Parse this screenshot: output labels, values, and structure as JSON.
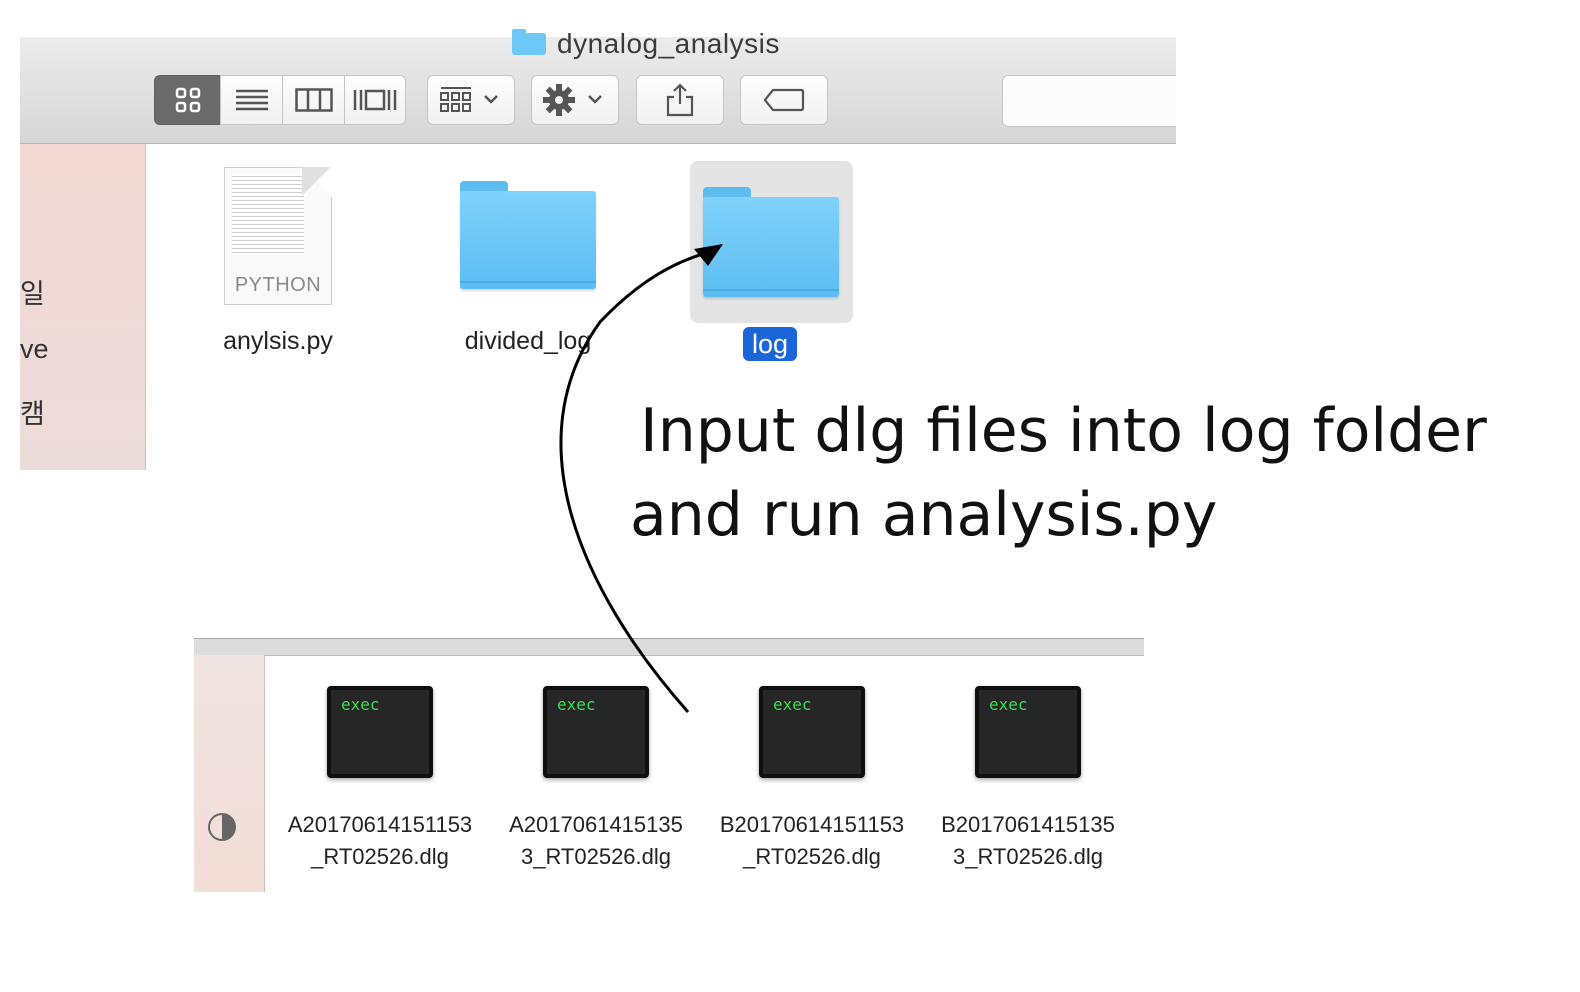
{
  "window": {
    "title": "dynalog_analysis"
  },
  "toolbar": {
    "icons": [
      "grid-view-icon",
      "list-view-icon",
      "column-view-icon",
      "coverflow-view-icon",
      "arrange-icon",
      "gear-icon",
      "share-icon",
      "tag-icon"
    ]
  },
  "sidebar_top": {
    "labels": [
      "일",
      "ve",
      "캠"
    ]
  },
  "top_files": [
    {
      "name": "anylsis.py",
      "type": "PYTHON",
      "kind": "document"
    },
    {
      "name": "divided_log",
      "kind": "folder"
    },
    {
      "name": "log",
      "kind": "folder",
      "selected": true
    }
  ],
  "annotation": {
    "line1": "Input dlg files into log folder",
    "line2": "and run analysis.py"
  },
  "bottom_files": [
    {
      "icon_text": "exec",
      "line1": "A20170614151153",
      "line2": "_RT02526.dlg"
    },
    {
      "icon_text": "exec",
      "line1": "A2017061415135",
      "line2": "3_RT02526.dlg"
    },
    {
      "icon_text": "exec",
      "line1": "B20170614151153",
      "line2": "_RT02526.dlg"
    },
    {
      "icon_text": "exec",
      "line1": "B2017061415135",
      "line2": "3_RT02526.dlg"
    }
  ],
  "colors": {
    "selection": "#1a66d9",
    "folder": "#6cc8f6",
    "terminal_text": "#3ddc55"
  }
}
